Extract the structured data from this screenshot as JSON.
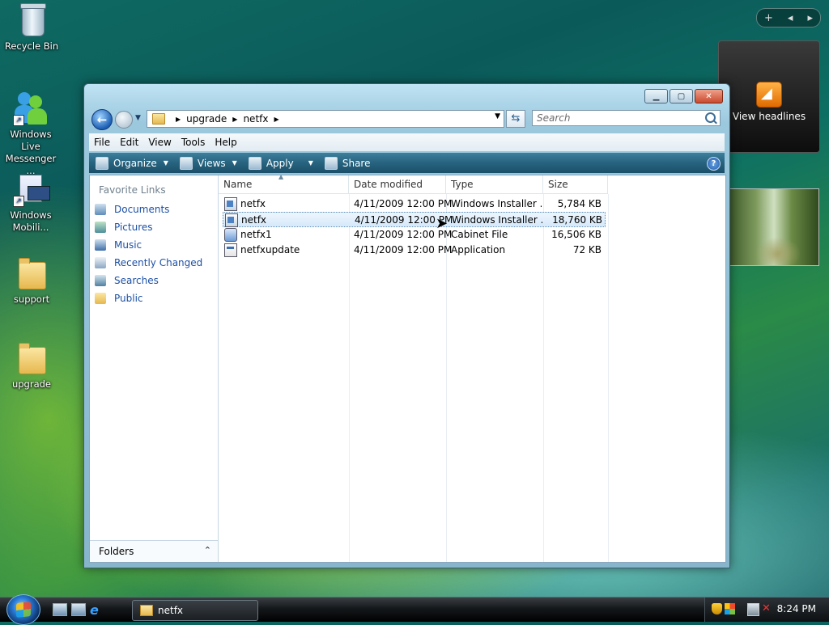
{
  "desktop": {
    "icons": [
      {
        "label": "Recycle Bin"
      },
      {
        "label": "Windows Live Messenger ..."
      },
      {
        "label": "Windows Mobili..."
      },
      {
        "label": "support"
      },
      {
        "label": "upgrade"
      }
    ]
  },
  "gadgets": {
    "controls": {
      "add": "+",
      "prev": "◂",
      "next": "▸"
    },
    "rss_label": "View headlines"
  },
  "window": {
    "address": {
      "crumbs": [
        "upgrade",
        "netfx"
      ]
    },
    "search_placeholder": "Search",
    "menu": [
      "File",
      "Edit",
      "View",
      "Tools",
      "Help"
    ],
    "toolbar": {
      "organize": "Organize",
      "views": "Views",
      "apply": "Apply",
      "share": "Share"
    },
    "nav": {
      "header": "Favorite Links",
      "items": [
        "Documents",
        "Pictures",
        "Music",
        "Recently Changed",
        "Searches",
        "Public"
      ],
      "folders_label": "Folders"
    },
    "columns": {
      "name": "Name",
      "date": "Date modified",
      "type": "Type",
      "size": "Size"
    },
    "files": [
      {
        "name": "netfx",
        "date": "4/11/2009 12:00 PM",
        "type": "Windows Installer ...",
        "size": "5,784 KB",
        "icon": "msi-file-icon"
      },
      {
        "name": "netfx",
        "date": "4/11/2009 12:00 PM",
        "type": "Windows Installer ...",
        "size": "18,760 KB",
        "icon": "msi-file-icon"
      },
      {
        "name": "netfx1",
        "date": "4/11/2009 12:00 PM",
        "type": "Cabinet File",
        "size": "16,506 KB",
        "icon": "cabinet-file-icon"
      },
      {
        "name": "netfxupdate",
        "date": "4/11/2009 12:00 PM",
        "type": "Application",
        "size": "72 KB",
        "icon": "application-file-icon"
      }
    ]
  },
  "taskbar": {
    "task_label": "netfx",
    "clock": "8:24 PM"
  },
  "colors": {
    "selection": "#d5e9f9",
    "link": "#1c50a5",
    "toolbar": "#27637f"
  }
}
